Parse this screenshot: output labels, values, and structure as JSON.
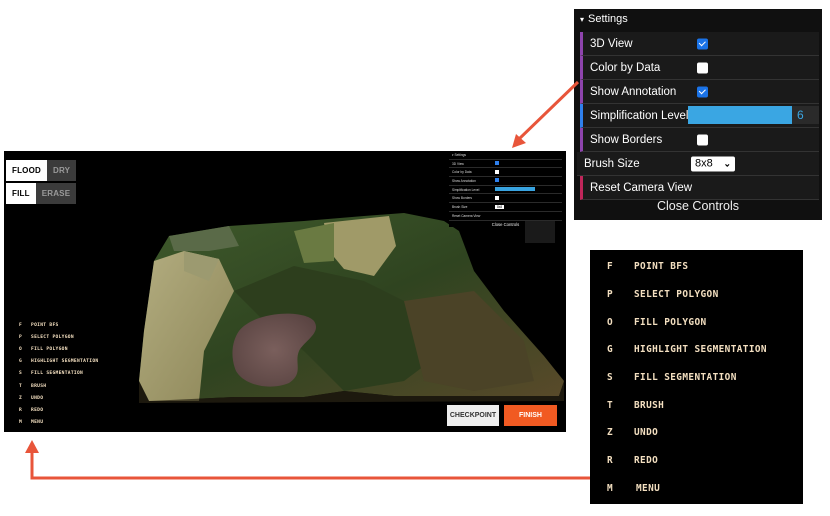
{
  "app": {
    "flood_label": "FLOOD",
    "dry_label": "DRY",
    "fill_label": "FILL",
    "erase_label": "ERASE",
    "checkpoint_label": "CHECKPOINT",
    "finish_label": "FINISH"
  },
  "settings": {
    "header": "Settings",
    "view3d_label": "3D View",
    "view3d_checked": true,
    "color_by_data_label": "Color by Data",
    "color_by_data_checked": false,
    "show_annotation_label": "Show Annotation",
    "show_annotation_checked": true,
    "simplification_label": "Simplification Level",
    "simplification_value": "6",
    "show_borders_label": "Show Borders",
    "show_borders_checked": false,
    "brush_size_label": "Brush Size",
    "brush_size_value": "8x8",
    "reset_camera_label": "Reset Camera View",
    "close_label": "Close Controls"
  },
  "hotkeys": [
    {
      "key": "F",
      "action": "POINT BFS"
    },
    {
      "key": "P",
      "action": "SELECT POLYGON"
    },
    {
      "key": "O",
      "action": "FILL POLYGON"
    },
    {
      "key": "G",
      "action": "HIGHLIGHT SEGMENTATION"
    },
    {
      "key": "S",
      "action": "FILL SEGMENTATION"
    },
    {
      "key": "T",
      "action": "BRUSH"
    },
    {
      "key": "Z",
      "action": "UNDO"
    },
    {
      "key": "R",
      "action": "REDO"
    },
    {
      "key": "M",
      "action": "MENU"
    }
  ],
  "colors": {
    "arrow": "#e8553a",
    "finish": "#f15a22",
    "checkbox_on": "#1a73e8",
    "slider": "#3aa6e3",
    "hotkey_text": "#f3dfc0"
  }
}
